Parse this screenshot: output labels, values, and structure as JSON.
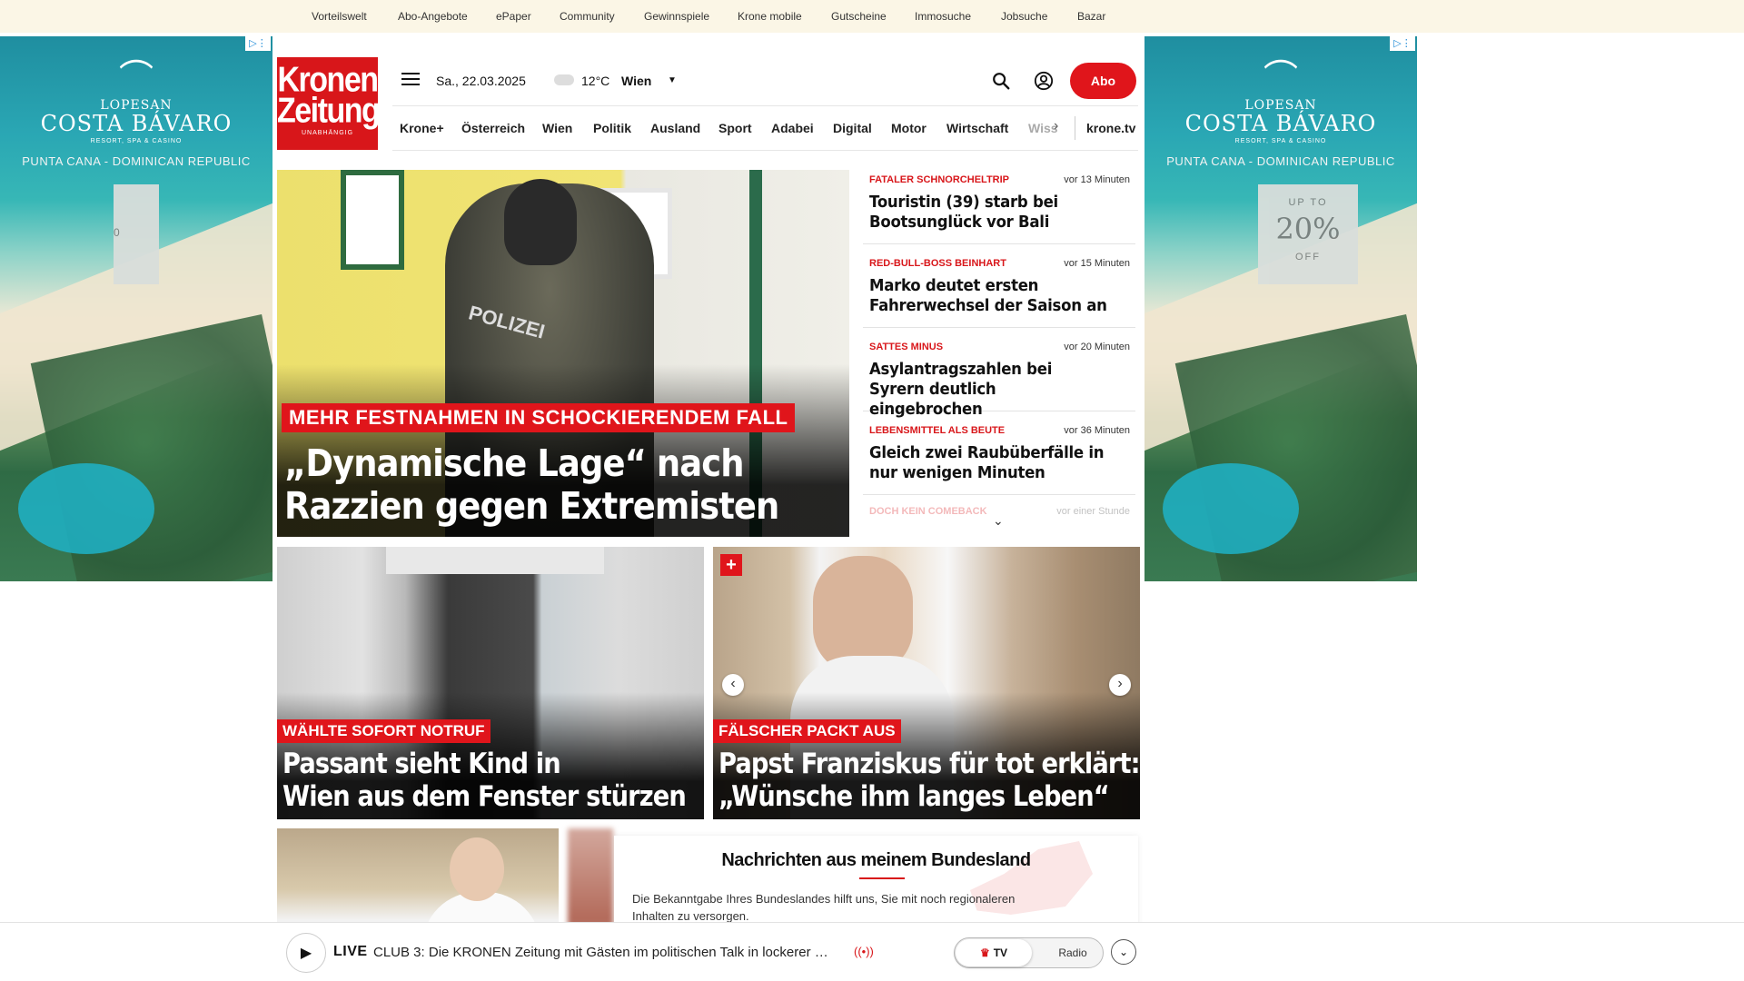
{
  "topbar": {
    "links": [
      "Vorteilswelt",
      "Abo-Angebote",
      "ePaper",
      "Community",
      "Gewinnspiele",
      "Krone mobile",
      "Gutscheine",
      "Immosuche",
      "Jobsuche",
      "Bazar"
    ]
  },
  "ads": {
    "brand_small": "LOPESAN",
    "brand": "COSTA BÁVARO",
    "resort": "RESORT, SPA & CASINO",
    "location": "PUNTA CANA - DOMINICAN REPUBLIC",
    "offer_up": "UP TO",
    "offer_pct": "20%",
    "offer_off": "OFF",
    "left_offer_fragment": "0"
  },
  "header": {
    "logo_line1": "Kronen",
    "logo_line2": "Zeitung",
    "logo_tagline": "UNABHÄNGIG",
    "date": "Sa., 22.03.2025",
    "temperature": "12°C",
    "city": "Wien",
    "subscribe_label": "Abo"
  },
  "nav": {
    "items": [
      "Krone+",
      "Österreich",
      "Wien",
      "Politik",
      "Ausland",
      "Sport",
      "Adabei",
      "Digital",
      "Motor",
      "Wirtschaft"
    ],
    "faded_item": "Wiss",
    "tv_link": "krone.tv"
  },
  "hero": {
    "kicker": "MEHR FESTNAHMEN IN SCHOCKIERENDEM FALL",
    "title": "„Dynamische Lage“ nach Razzien gegen Extremisten",
    "image_text": "POLIZEI"
  },
  "ticker": {
    "items": [
      {
        "kicker": "FATALER SCHNORCHELTRIP",
        "time": "vor 13 Minuten",
        "headline": "Touristin (39) starb bei Bootsunglück vor Bali"
      },
      {
        "kicker": "RED-BULL-BOSS BEINHART",
        "time": "vor 15 Minuten",
        "headline": "Marko deutet ersten Fahrerwechsel der Saison an"
      },
      {
        "kicker": "SATTES MINUS",
        "time": "vor 20 Minuten",
        "headline": "Asylantragszahlen bei Syrern deutlich eingebrochen"
      },
      {
        "kicker": "LEBENSMITTEL ALS BEUTE",
        "time": "vor 36 Minuten",
        "headline": "Gleich zwei Raubüberfälle in nur wenigen Minuten"
      },
      {
        "kicker": "DOCH KEIN COMEBACK",
        "time": "vor einer Stunde",
        "headline": ""
      }
    ]
  },
  "cards": [
    {
      "kicker": "WÄHLTE SOFORT NOTRUF",
      "title_line1": "Passant sieht Kind in",
      "title_line2": "Wien aus dem Fenster stürzen"
    },
    {
      "kicker": "FÄLSCHER PACKT AUS",
      "title_line1": "Papst Franziskus für tot erklärt:",
      "title_line2": "„Wünsche ihm langes Leben“"
    }
  ],
  "region": {
    "title": "Nachrichten aus meinem Bundesland",
    "text": "Die Bekanntgabe Ihres Bundeslandes hilft uns, Sie mit noch regionaleren Inhalten zu versorgen."
  },
  "live": {
    "label": "LIVE",
    "text": "CLUB 3: Die KRONEN Zeitung mit Gästen im politischen Talk in lockerer …",
    "tv_label": "TV",
    "radio_label": "Radio"
  },
  "colors": {
    "brand_red": "#d8161a",
    "topbar_bg": "#fbf6e6"
  }
}
